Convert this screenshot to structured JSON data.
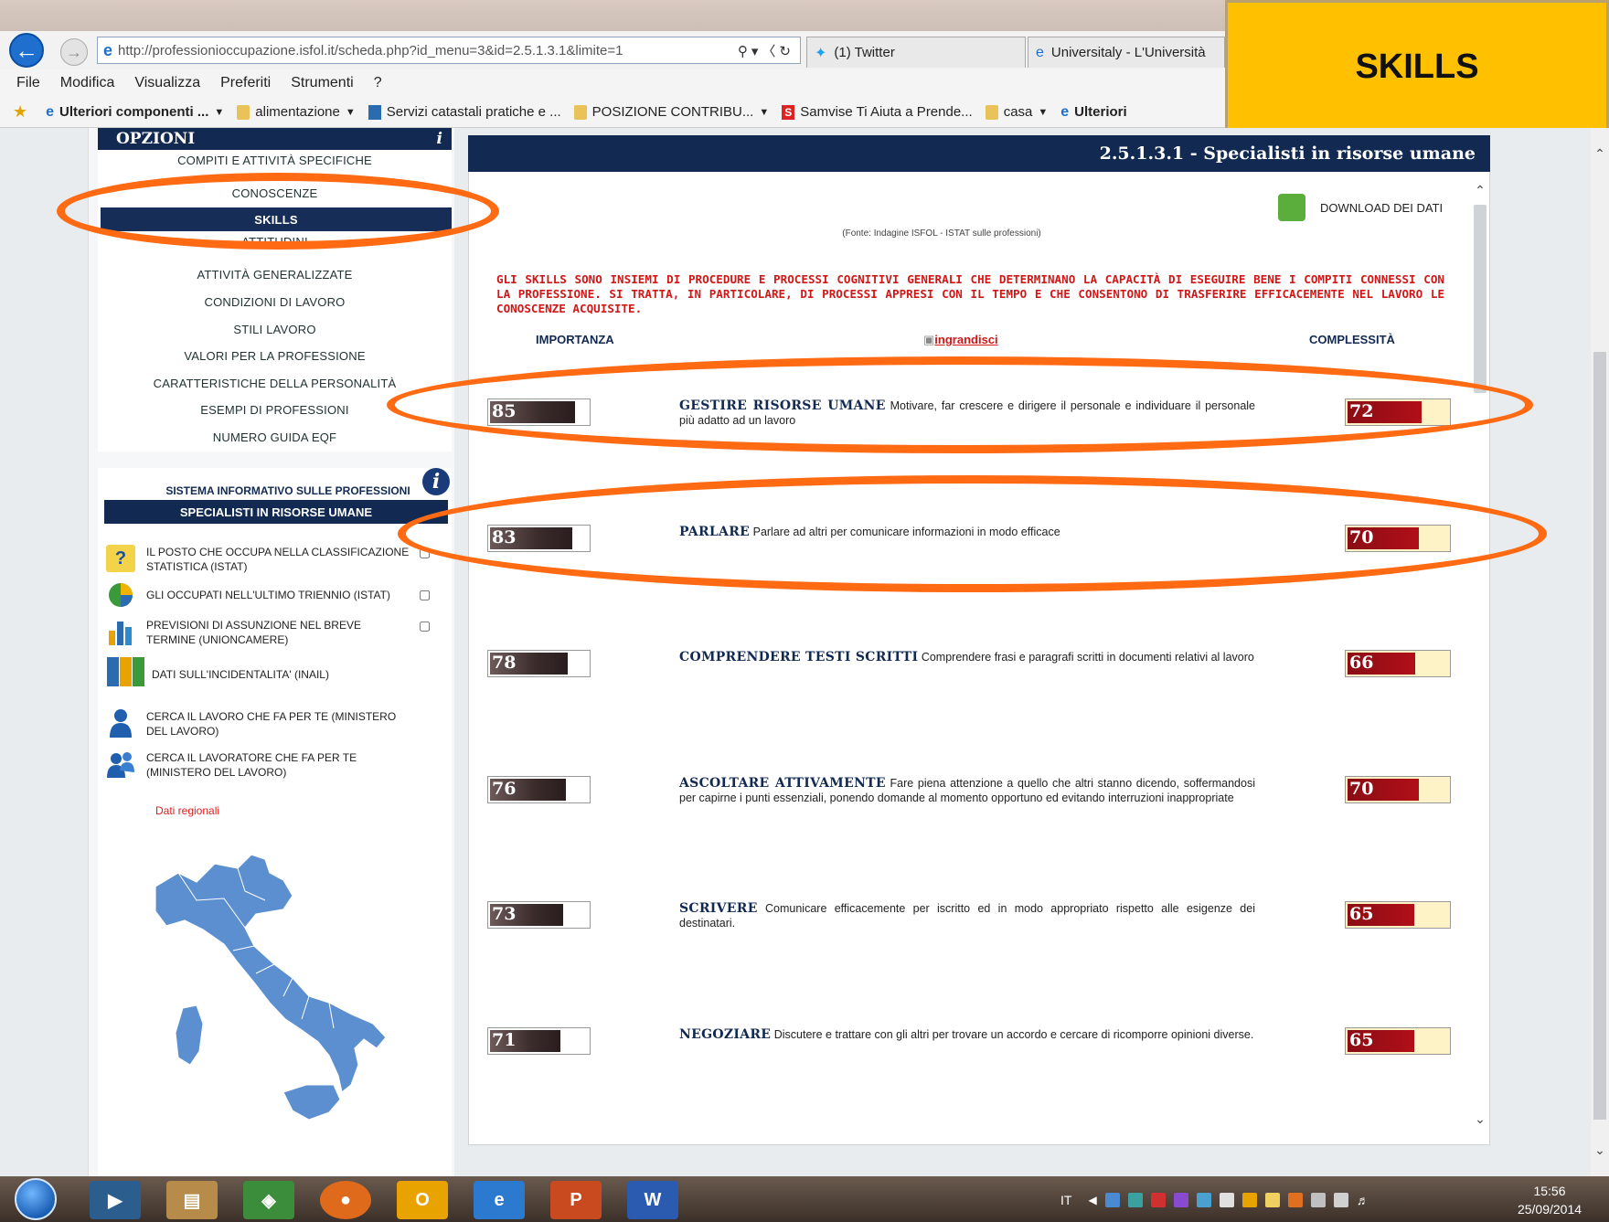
{
  "browser": {
    "url": "http://professionioccupazione.isfol.it/scheda.php?id_menu=3&id=2.5.1.3.1&limite=1",
    "url_host": "professionioccupazione.isfol.it",
    "tabs": [
      {
        "label": "(1) Twitter"
      },
      {
        "label": "Universitaly - L'Università"
      }
    ],
    "menu": [
      "File",
      "Modifica",
      "Visualizza",
      "Preferiti",
      "Strumenti",
      "?"
    ],
    "favorites": [
      {
        "label": "Ulteriori componenti ...",
        "icon": "ie-icon",
        "dropdown": true
      },
      {
        "label": "alimentazione",
        "icon": "folder-icon",
        "dropdown": true
      },
      {
        "label": "Servizi catastali pratiche e ...",
        "icon": "site-icon",
        "dropdown": false
      },
      {
        "label": "POSIZIONE CONTRIBU...",
        "icon": "folder-icon",
        "dropdown": true
      },
      {
        "label": "Samvise Ti Aiuta a Prende...",
        "icon": "s-icon",
        "dropdown": false
      },
      {
        "label": "casa",
        "icon": "folder-icon",
        "dropdown": true
      },
      {
        "label": "Ulteriori",
        "icon": "ie-icon",
        "dropdown": false
      }
    ]
  },
  "badge": {
    "label": "SKILLS",
    "color": "#ffc000"
  },
  "sidebar": {
    "header": "OPZIONI",
    "header_info": "i",
    "options": [
      {
        "label": "COMPITI E ATTIVITÀ SPECIFICHE",
        "active": false
      },
      {
        "label": "CONOSCENZE",
        "active": false
      },
      {
        "label": "SKILLS",
        "active": true
      },
      {
        "label": "ATTITUDINI",
        "active": false
      },
      {
        "label": "ATTIVITÀ GENERALIZZATE",
        "active": false
      },
      {
        "label": "CONDIZIONI DI LAVORO",
        "active": false
      },
      {
        "label": "STILI LAVORO",
        "active": false
      },
      {
        "label": "VALORI PER LA PROFESSIONE",
        "active": false
      },
      {
        "label": "CARATTERISTICHE DELLA PERSONALITÀ",
        "active": false
      },
      {
        "label": "ESEMPI DI PROFESSIONI",
        "active": false
      },
      {
        "label": "NUMERO GUIDA EQF",
        "active": false
      }
    ],
    "sis_title": "SISTEMA INFORMATIVO SULLE PROFESSIONI",
    "sis_subtitle": "SPECIALISTI IN RISORSE UMANE",
    "sis_items": [
      {
        "label": "IL POSTO CHE OCCUPA NELLA CLASSIFICAZIONE STATISTICA (ISTAT)",
        "icon": "question-book-icon",
        "external": true
      },
      {
        "label": "GLI OCCUPATI NELL'ULTIMO TRIENNIO (ISTAT)",
        "icon": "pie-chart-icon",
        "external": true
      },
      {
        "label": "PREVISIONI DI ASSUNZIONE NEL BREVE TERMINE (UNIONCAMERE)",
        "icon": "bar-chart-icon",
        "external": true
      },
      {
        "label": "DATI SULL'INCIDENTALITA' (INAIL)",
        "icon": "binders-icon",
        "external": false
      },
      {
        "label": "CERCA IL LAVORO CHE FA PER TE (MINISTERO DEL LAVORO)",
        "icon": "person-icon",
        "external": false
      },
      {
        "label": "CERCA IL LAVORATORE CHE FA PER TE (MINISTERO DEL LAVORO)",
        "icon": "people-icon",
        "external": false
      }
    ],
    "regional_link": "Dati regionali"
  },
  "content": {
    "title": "2.5.1.3.1 - Specialisti in risorse umane",
    "download_label": "DOWNLOAD DEI DATI",
    "source": "(Fonte: Indagine ISFOL - ISTAT sulle professioni)",
    "intro": "GLI SKILLS SONO INSIEMI DI PROCEDURE E PROCESSI COGNITIVI GENERALI CHE DETERMINANO LA CAPACITÀ DI ESEGUIRE BENE I COMPITI CONNESSI CON LA PROFESSIONE. SI TRATTA, IN PARTICOLARE, DI PROCESSI APPRESI CON IL TEMPO E CHE CONSENTONO DI TRASFERIRE EFFICACEMENTE NEL LAVORO LE CONOSCENZE ACQUISITE.",
    "col_importance": "IMPORTANZA",
    "col_zoom": "ingrandisci",
    "col_complexity": "COMPLESSITÀ",
    "skills": [
      {
        "name": "GESTIRE RISORSE UMANE",
        "description": "Motivare, far crescere e dirigere il personale e individuare il personale più adatto ad un lavoro",
        "importance": 85,
        "complexity": 72,
        "highlighted": true
      },
      {
        "name": "PARLARE",
        "description": "Parlare ad altri per comunicare informazioni in modo efficace",
        "importance": 83,
        "complexity": 70,
        "highlighted": true
      },
      {
        "name": "COMPRENDERE TESTI SCRITTI",
        "description": "Comprendere frasi e paragrafi scritti in documenti relativi al lavoro",
        "importance": 78,
        "complexity": 66,
        "highlighted": false
      },
      {
        "name": "ASCOLTARE ATTIVAMENTE",
        "description": "Fare piena attenzione a quello che altri stanno dicendo, soffermandosi per capirne i punti essenziali, ponendo domande al momento opportuno ed evitando interruzioni inappropriate",
        "importance": 76,
        "complexity": 70,
        "highlighted": false
      },
      {
        "name": "SCRIVERE",
        "description": "Comunicare efficacemente per iscritto ed in modo appropriato rispetto alle esigenze dei destinatari.",
        "importance": 73,
        "complexity": 65,
        "highlighted": false
      },
      {
        "name": "NEGOZIARE",
        "description": "Discutere e trattare con gli altri per trovare un accordo e cercare di ricomporre opinioni diverse.",
        "importance": 71,
        "complexity": 65,
        "highlighted": false
      }
    ]
  },
  "taskbar": {
    "language": "IT",
    "time": "15:56",
    "date": "25/09/2014",
    "apps": [
      "media-player-icon",
      "file-explorer-icon",
      "windows-live-icon",
      "firefox-icon",
      "outlook-icon",
      "internet-explorer-icon",
      "powerpoint-icon",
      "word-icon"
    ]
  },
  "colors": {
    "accent_navy": "#122a52",
    "highlight_oval": "#ff6a13",
    "intro_red": "#d01818"
  }
}
